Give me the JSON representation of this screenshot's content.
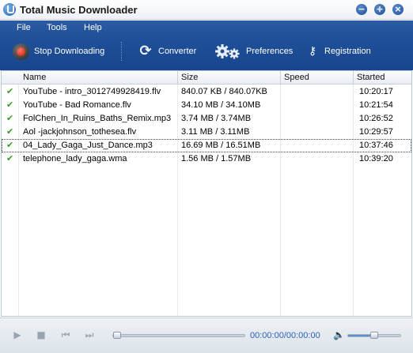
{
  "window": {
    "title": "Total Music Downloader"
  },
  "menu": {
    "file": "File",
    "tools": "Tools",
    "help": "Help"
  },
  "toolbar": {
    "stop": "Stop Downloading",
    "converter": "Converter",
    "preferences": "Preferences",
    "registration": "Registration"
  },
  "columns": {
    "name": "Name",
    "size": "Size",
    "speed": "Speed",
    "started": "Started"
  },
  "rows": [
    {
      "status": "✔",
      "name": "YouTube - intro_3012749928419.flv",
      "size": "840.07 KB / 840.07KB",
      "speed": "",
      "started": "10:20:17"
    },
    {
      "status": "✔",
      "name": "YouTube - Bad Romance.flv",
      "size": "34.10 MB / 34.10MB",
      "speed": "",
      "started": "10:21:54"
    },
    {
      "status": "✔",
      "name": "FolChen_In_Ruins_Baths_Remix.mp3",
      "size": "3.74 MB / 3.74MB",
      "speed": "",
      "started": "10:26:52"
    },
    {
      "status": "✔",
      "name": "Aol -jackjohnson_tothesea.flv",
      "size": "3.11 MB / 3.11MB",
      "speed": "",
      "started": "10:29:57"
    },
    {
      "status": "✔",
      "name": "04_Lady_Gaga_Just_Dance.mp3",
      "size": "16.69 MB / 16.51MB",
      "speed": "",
      "started": "10:37:46"
    },
    {
      "status": "✔",
      "name": "telephone_lady_gaga.wma",
      "size": "1.56 MB / 1.57MB",
      "speed": "",
      "started": "10:39:20"
    }
  ],
  "player": {
    "time": "00:00:00/00:00:00",
    "seek_fraction": 0,
    "volume_fraction": 0.5
  },
  "icons": {
    "app": "app-logo-icon",
    "stop": "stop-record-icon",
    "converter": "refresh-icon",
    "preferences": "gears-icon",
    "registration": "key-icon",
    "check": "check-icon",
    "play": "play-icon",
    "stop_player": "stop-icon",
    "prev": "previous-icon",
    "next": "next-icon",
    "volume": "speaker-icon"
  },
  "colors": {
    "header_blue": "#1f4f98",
    "check_green": "#3a9a28",
    "time_blue": "#2a62b8"
  }
}
